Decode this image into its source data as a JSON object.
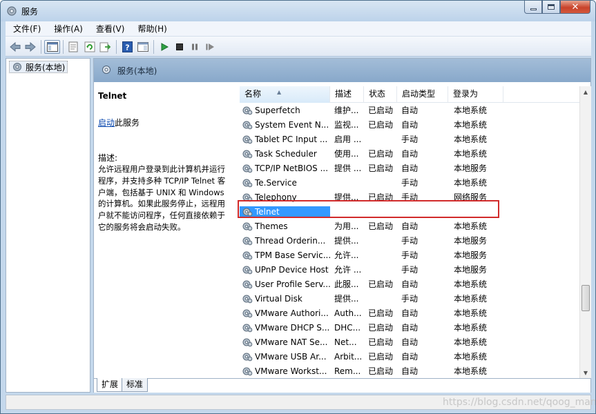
{
  "window": {
    "title": "服务"
  },
  "menu": [
    "文件(F)",
    "操作(A)",
    "查看(V)",
    "帮助(H)"
  ],
  "toolbar": {
    "icons": [
      "back-icon",
      "forward-icon",
      "console-tree-icon",
      "properties-icon",
      "refresh-icon",
      "export-list-icon",
      "help-icon",
      "show-hide-icon",
      "start-service-icon",
      "stop-service-icon",
      "pause-service-icon",
      "resume-service-icon"
    ]
  },
  "tree": {
    "root_label": "服务(本地)"
  },
  "pane": {
    "header_title": "服务(本地)"
  },
  "description": {
    "service_name": "Telnet",
    "start_link": "启动",
    "start_suffix": "此服务",
    "desc_label": "描述:",
    "desc_text": "允许远程用户登录到此计算机并运行程序，并支持多种 TCP/IP Telnet 客户端，包括基于 UNIX 和 Windows 的计算机。如果此服务停止，远程用户就不能访问程序，任何直接依赖于它的服务将会启动失败。"
  },
  "columns": [
    "名称",
    "描述",
    "状态",
    "启动类型",
    "登录为"
  ],
  "services": [
    {
      "name": "Superfetch",
      "desc": "维护...",
      "status": "已启动",
      "startup": "自动",
      "logon": "本地系统"
    },
    {
      "name": "System Event N...",
      "desc": "监视...",
      "status": "已启动",
      "startup": "自动",
      "logon": "本地系统"
    },
    {
      "name": "Tablet PC Input ...",
      "desc": "启用 ...",
      "status": "",
      "startup": "手动",
      "logon": "本地系统"
    },
    {
      "name": "Task Scheduler",
      "desc": "使用...",
      "status": "已启动",
      "startup": "自动",
      "logon": "本地系统"
    },
    {
      "name": "TCP/IP NetBIOS ...",
      "desc": "提供 ...",
      "status": "已启动",
      "startup": "自动",
      "logon": "本地服务"
    },
    {
      "name": "Te.Service",
      "desc": "",
      "status": "",
      "startup": "手动",
      "logon": "本地系统"
    },
    {
      "name": "Telephony",
      "desc": "提供...",
      "status": "已启动",
      "startup": "手动",
      "logon": "网络服务"
    },
    {
      "name": "Telnet",
      "desc": "",
      "status": "",
      "startup": "",
      "logon": "",
      "selected": true
    },
    {
      "name": "Themes",
      "desc": "为用...",
      "status": "已启动",
      "startup": "自动",
      "logon": "本地系统"
    },
    {
      "name": "Thread Orderin...",
      "desc": "提供...",
      "status": "",
      "startup": "手动",
      "logon": "本地服务"
    },
    {
      "name": "TPM Base Servic...",
      "desc": "允许...",
      "status": "",
      "startup": "手动",
      "logon": "本地服务"
    },
    {
      "name": "UPnP Device Host",
      "desc": "允许 ...",
      "status": "",
      "startup": "手动",
      "logon": "本地服务"
    },
    {
      "name": "User Profile Serv...",
      "desc": "此服...",
      "status": "已启动",
      "startup": "自动",
      "logon": "本地系统"
    },
    {
      "name": "Virtual Disk",
      "desc": "提供...",
      "status": "",
      "startup": "手动",
      "logon": "本地系统"
    },
    {
      "name": "VMware Authori...",
      "desc": "Auth...",
      "status": "已启动",
      "startup": "自动",
      "logon": "本地系统"
    },
    {
      "name": "VMware DHCP S...",
      "desc": "DHC...",
      "status": "已启动",
      "startup": "自动",
      "logon": "本地系统"
    },
    {
      "name": "VMware NAT Se...",
      "desc": "Net...",
      "status": "已启动",
      "startup": "自动",
      "logon": "本地系统"
    },
    {
      "name": "VMware USB Ar...",
      "desc": "Arbit...",
      "status": "已启动",
      "startup": "自动",
      "logon": "本地系统"
    },
    {
      "name": "VMware Workst...",
      "desc": "Rem...",
      "status": "已启动",
      "startup": "自动",
      "logon": "本地系统"
    }
  ],
  "tabs": [
    "扩展",
    "标准"
  ],
  "watermark": "https://blog.csdn.net/qoog_man",
  "colors": {
    "selection": "#3399ff",
    "highlight_box": "#d12a2a",
    "header_band": "#94b2d2"
  }
}
